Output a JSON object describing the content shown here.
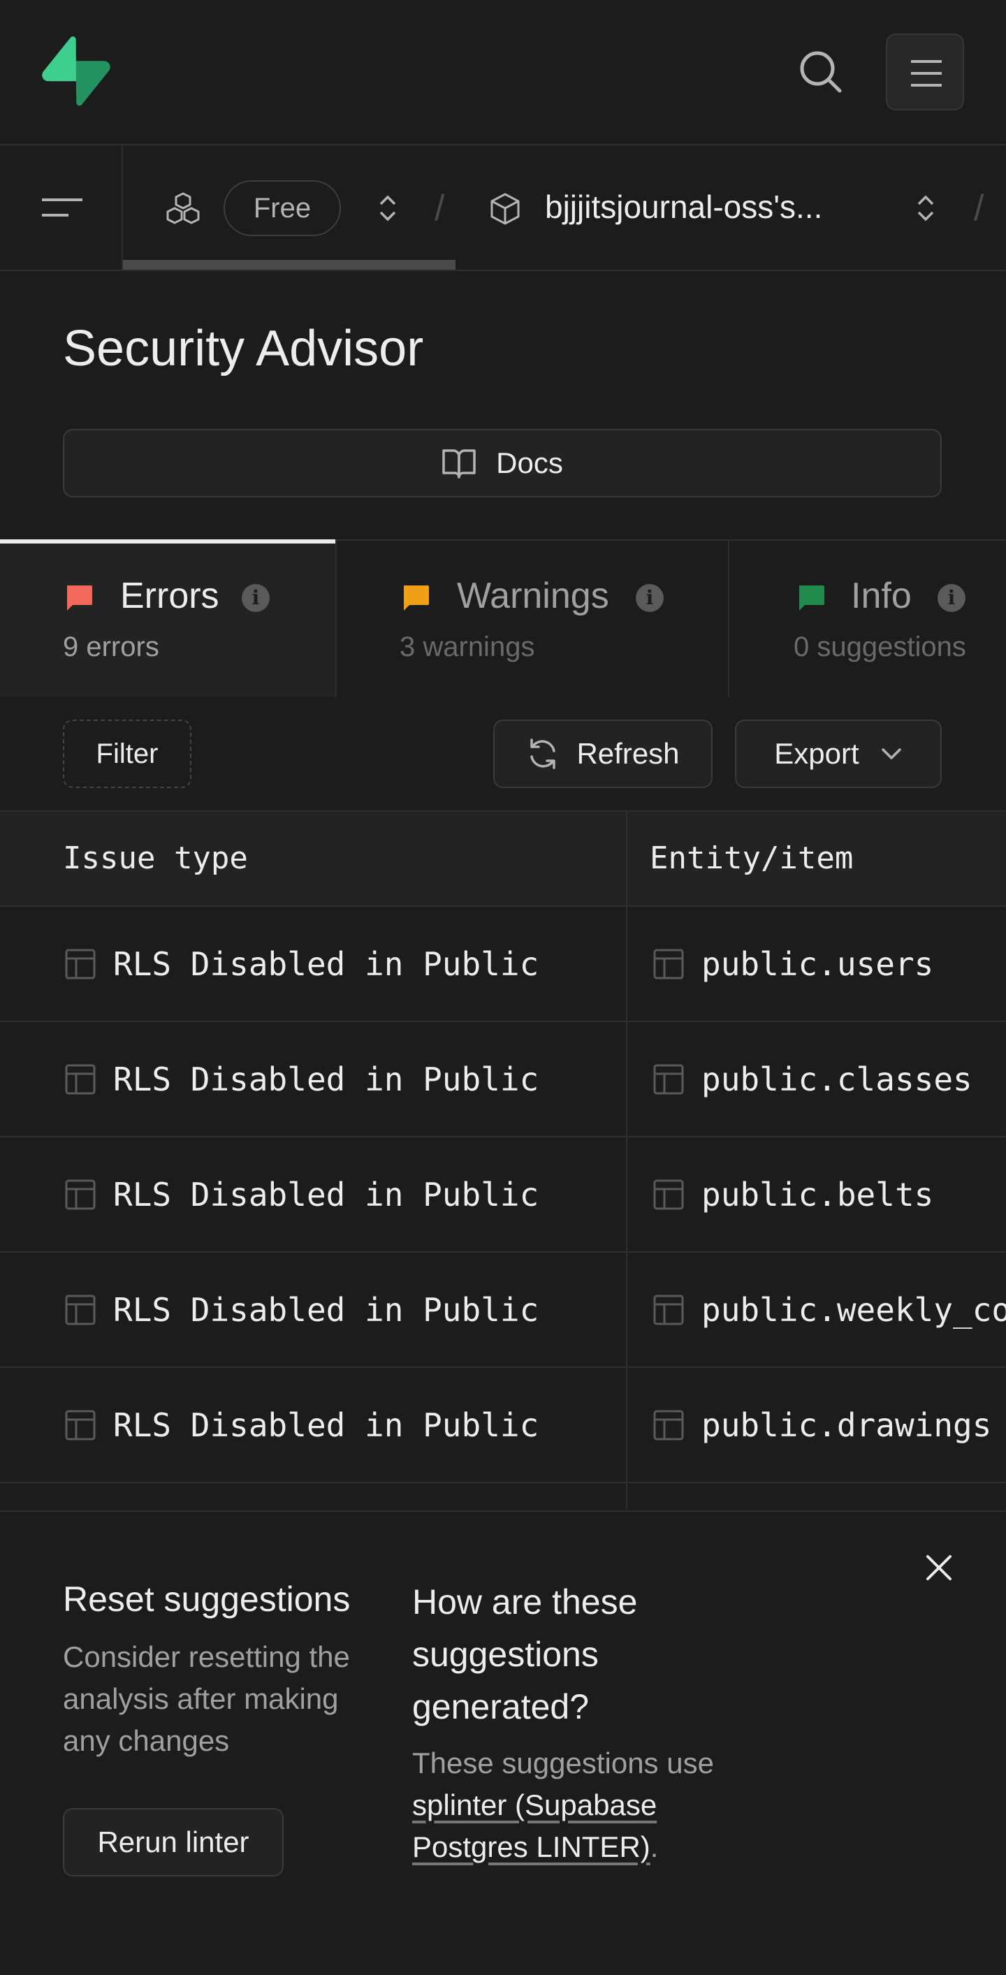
{
  "header": {
    "logo": "supabase-logo",
    "search_icon": "search-icon",
    "menu_icon": "hamburger-menu-icon"
  },
  "breadcrumb": {
    "sidebar_toggle_icon": "sidebar-toggle-icon",
    "org_icon": "boxes-icon",
    "plan": "Free",
    "separator": "/",
    "project_icon": "box-icon",
    "project_name": "bjjjitsjournal-oss's..."
  },
  "page": {
    "title": "Security Advisor",
    "docs_label": "Docs"
  },
  "tabs": [
    {
      "label": "Errors",
      "count": "9 errors",
      "color": "#f2695b",
      "active": true
    },
    {
      "label": "Warnings",
      "count": "3 warnings",
      "color": "#f0a016",
      "active": false
    },
    {
      "label": "Info",
      "count": "0 suggestions",
      "color": "#1f8a4c",
      "active": false
    }
  ],
  "toolbar": {
    "filter_label": "Filter",
    "refresh_label": "Refresh",
    "export_label": "Export"
  },
  "table": {
    "columns": [
      "Issue type",
      "Entity/item"
    ],
    "rows": [
      {
        "issue": "RLS Disabled in Public",
        "entity": "public.users"
      },
      {
        "issue": "RLS Disabled in Public",
        "entity": "public.classes"
      },
      {
        "issue": "RLS Disabled in Public",
        "entity": "public.belts"
      },
      {
        "issue": "RLS Disabled in Public",
        "entity": "public.weekly_commitments"
      },
      {
        "issue": "RLS Disabled in Public",
        "entity": "public.drawings"
      }
    ]
  },
  "panel": {
    "reset_title": "Reset suggestions",
    "reset_desc": "Consider resetting the analysis after making any changes",
    "rerun_label": "Rerun linter",
    "how_title": "How are these suggestions generated?",
    "how_desc_prefix": "These suggestions use ",
    "how_link": "splinter (Supabase Postgres LINTER)",
    "how_desc_suffix": "."
  },
  "colors": {
    "brand": "#3ecf8e",
    "background": "#1c1c1c"
  }
}
